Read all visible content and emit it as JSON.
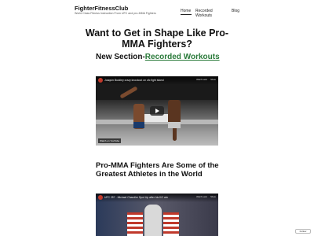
{
  "site": {
    "title": "FighterFitnessClub",
    "tagline": "World Class Fitness Instruction From UFC and pro-MMA Fighters"
  },
  "nav": {
    "items": [
      {
        "label": "Home",
        "active": true
      },
      {
        "label": "Recorded Workouts",
        "active": false
      },
      {
        "label": "Blog",
        "active": false
      }
    ]
  },
  "hero": {
    "heading": "Want to Get in Shape Like Pro-MMA Fighters?"
  },
  "section1": {
    "prefix": "New Section-",
    "link": "Recorded Workouts",
    "video": {
      "title": "Joaquin Buckley crazy knockout on ufc fight island",
      "watch_later": "Watch Later",
      "share": "Share",
      "watch_on": "Watch on YouTube"
    }
  },
  "section2": {
    "heading": "Pro-MMA Fighters Are Some of the Greatest Athletes in the World",
    "video": {
      "title": "UFC 257 - Michael Chandler Spot Up after his KO win",
      "watch_later": "Watch Later",
      "share": "Share"
    }
  },
  "follow_badge": "Follow",
  "colors": {
    "link_green": "#2a7a3a",
    "youtube_red": "#c0392b"
  }
}
